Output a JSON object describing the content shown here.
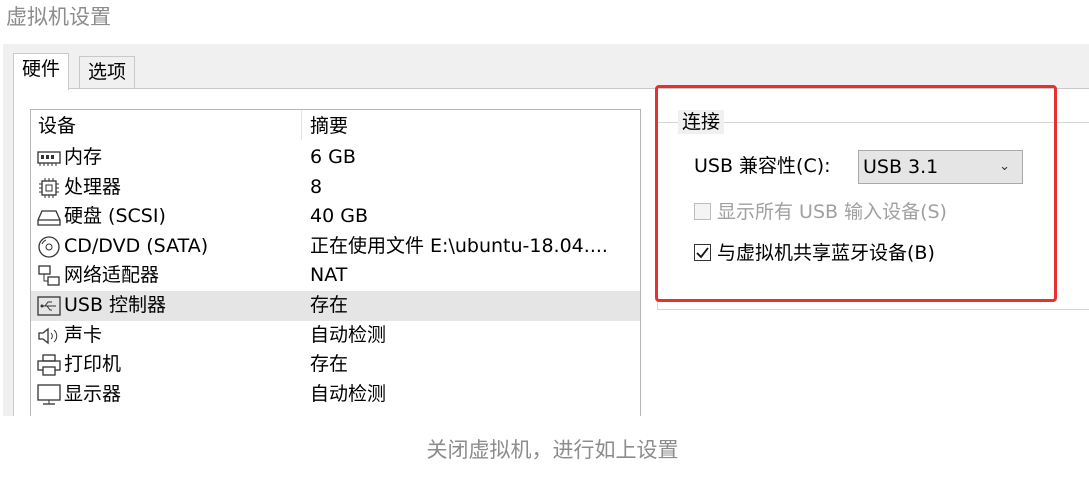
{
  "window": {
    "title": "虚拟机设置"
  },
  "tabs": [
    {
      "label": "硬件",
      "active": true
    },
    {
      "label": "选项",
      "active": false
    }
  ],
  "device_list": {
    "columns": [
      "设备",
      "摘要"
    ],
    "rows": [
      {
        "icon": "memory-icon",
        "name": "内存",
        "summary": "6 GB",
        "selected": false
      },
      {
        "icon": "processor-icon",
        "name": "处理器",
        "summary": "8",
        "selected": false
      },
      {
        "icon": "hard-disk-icon",
        "name": "硬盘 (SCSI)",
        "summary": "40 GB",
        "selected": false
      },
      {
        "icon": "cd-dvd-icon",
        "name": "CD/DVD (SATA)",
        "summary": "正在使用文件 E:\\ubuntu-18.04....",
        "selected": false
      },
      {
        "icon": "network-adapter-icon",
        "name": "网络适配器",
        "summary": "NAT",
        "selected": false
      },
      {
        "icon": "usb-icon",
        "name": "USB 控制器",
        "summary": "存在",
        "selected": true
      },
      {
        "icon": "speaker-icon",
        "name": "声卡",
        "summary": "自动检测",
        "selected": false
      },
      {
        "icon": "printer-icon",
        "name": "打印机",
        "summary": "存在",
        "selected": false
      },
      {
        "icon": "monitor-icon",
        "name": "显示器",
        "summary": "自动检测",
        "selected": false
      }
    ]
  },
  "connection": {
    "legend": "连接",
    "compat_label": "USB 兼容性(C):",
    "compat_value": "USB 3.1",
    "show_all_label": "显示所有 USB 输入设备(S)",
    "show_all_checked": false,
    "show_all_disabled": true,
    "share_bt_label": "与虚拟机共享蓝牙设备(B)",
    "share_bt_checked": true
  },
  "caption": "关闭虚拟机，进行如上设置",
  "colors": {
    "highlight": "#e8302c",
    "selected_row": "#e5e5e5",
    "dialog_bg": "#f0f0f0"
  }
}
